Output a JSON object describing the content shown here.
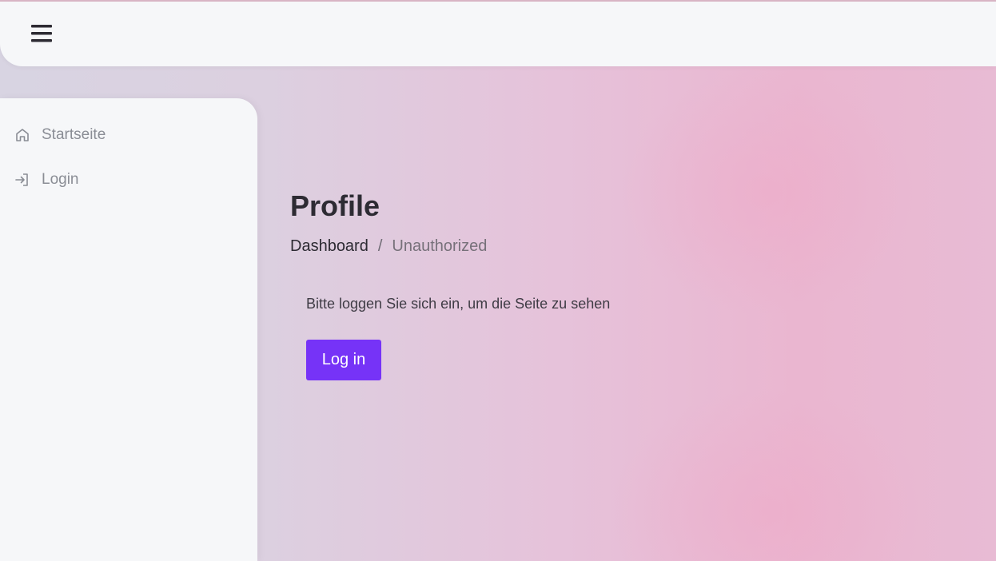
{
  "header": {
    "menu_icon": "hamburger-menu-icon"
  },
  "sidebar": {
    "items": [
      {
        "label": "Startseite",
        "icon": "home-icon"
      },
      {
        "label": "Login",
        "icon": "login-arrow-icon"
      }
    ]
  },
  "main": {
    "title": "Profile",
    "breadcrumb": {
      "link": "Dashboard",
      "separator": "/",
      "current": "Unauthorized"
    },
    "message": "Bitte loggen Sie sich ein, um die Seite zu sehen",
    "login_button": "Log in"
  },
  "colors": {
    "accent": "#7633f7",
    "panel": "#f6f7f9",
    "text_dark": "#2d2b33",
    "text_muted": "#8a8d95"
  }
}
